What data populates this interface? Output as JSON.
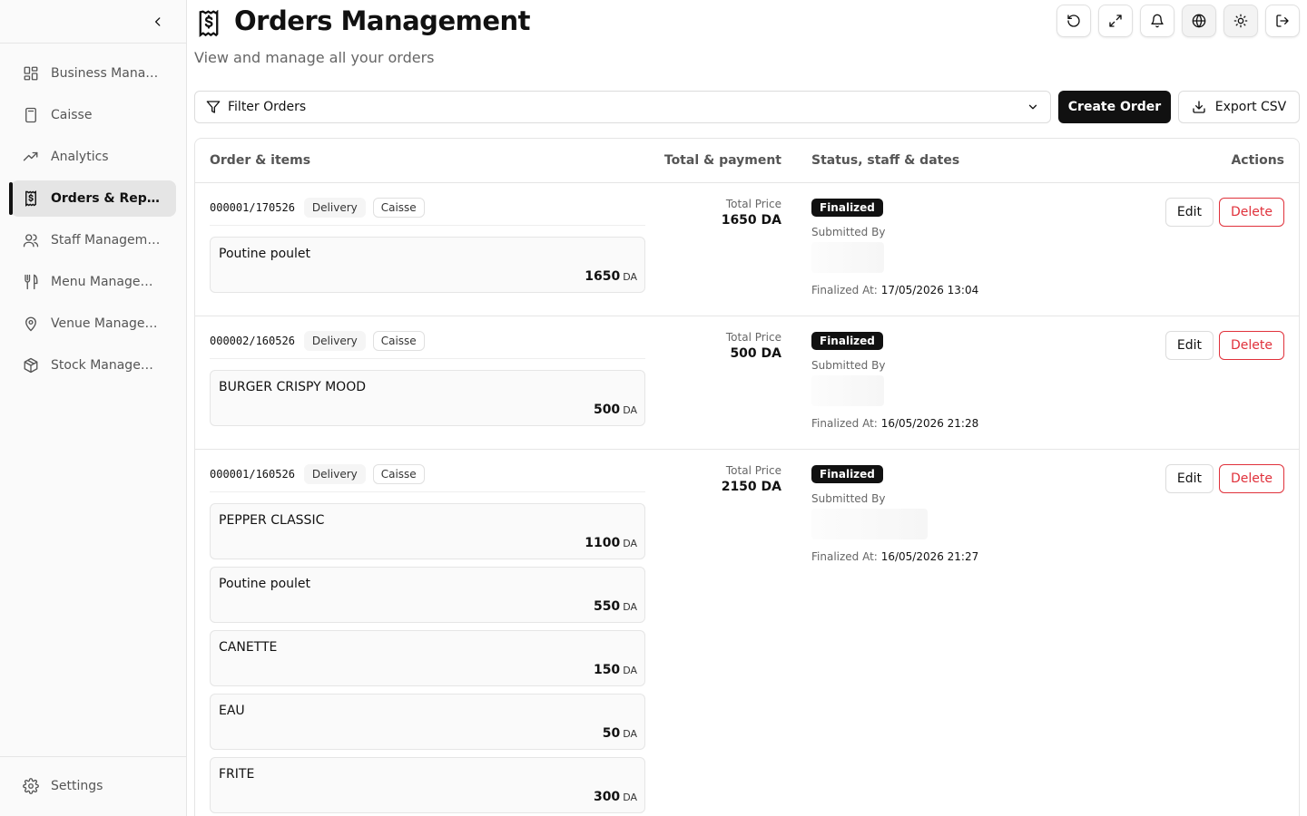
{
  "sidebar": {
    "items": [
      {
        "label": "Business Management",
        "icon": "dashboard-grid-icon",
        "active": false
      },
      {
        "label": "Caisse",
        "icon": "calculator-icon",
        "active": false
      },
      {
        "label": "Analytics",
        "icon": "trending-up-icon",
        "active": false
      },
      {
        "label": "Orders & Reports",
        "icon": "receipt-icon",
        "active": true
      },
      {
        "label": "Staff Management",
        "icon": "users-icon",
        "active": false
      },
      {
        "label": "Menu Management",
        "icon": "utensils-icon",
        "active": false
      },
      {
        "label": "Venue Management",
        "icon": "map-pin-icon",
        "active": false
      },
      {
        "label": "Stock Management",
        "icon": "package-icon",
        "active": false
      }
    ],
    "settings_label": "Settings"
  },
  "header": {
    "title": "Orders Management",
    "subtitle": "View and manage all your orders"
  },
  "toolbar": {
    "filter_label": "Filter Orders",
    "create_label": "Create Order",
    "export_label": "Export CSV"
  },
  "table": {
    "headers": {
      "order": "Order & items",
      "total": "Total & payment",
      "status": "Status, staff & dates",
      "actions": "Actions"
    },
    "total_label": "Total Price",
    "submitted_label": "Submitted By",
    "finalized_label": "Finalized At:",
    "edit_label": "Edit",
    "delete_label": "Delete",
    "currency": "DA",
    "orders": [
      {
        "id": "000001/170526",
        "type": "Delivery",
        "source": "Caisse",
        "total": "1650 DA",
        "status": "Finalized",
        "finalized_at": "17/05/2026 13:04",
        "items": [
          {
            "name": "Poutine poulet",
            "price": "1650"
          }
        ]
      },
      {
        "id": "000002/160526",
        "type": "Delivery",
        "source": "Caisse",
        "total": "500 DA",
        "status": "Finalized",
        "finalized_at": "16/05/2026 21:28",
        "items": [
          {
            "name": "BURGER CRISPY MOOD",
            "price": "500"
          }
        ]
      },
      {
        "id": "000001/160526",
        "type": "Delivery",
        "source": "Caisse",
        "total": "2150 DA",
        "status": "Finalized",
        "finalized_at": "16/05/2026 21:27",
        "items": [
          {
            "name": "PEPPER CLASSIC",
            "price": "1100"
          },
          {
            "name": "Poutine poulet",
            "price": "550"
          },
          {
            "name": "CANETTE",
            "price": "150"
          },
          {
            "name": "EAU",
            "price": "50"
          },
          {
            "name": "FRITE",
            "price": "300"
          }
        ]
      }
    ]
  },
  "colors": {
    "primary": "#111111",
    "danger": "#e0313b",
    "border": "#e5e5e5",
    "sidebar_bg": "#fafafa",
    "active_bg": "#e5e5e5"
  }
}
